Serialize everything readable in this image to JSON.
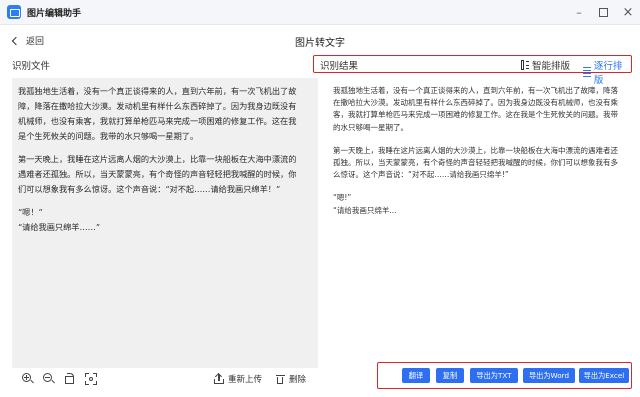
{
  "app": {
    "title": "图片编辑助手"
  },
  "nav": {
    "back_label": "返回",
    "page_title": "图片转文字"
  },
  "left": {
    "heading": "识别文件",
    "image_text": [
      "我孤独地生活着，没有一个真正谈得来的人，直到六年前，有一次飞机出了故障，降落在撒哈拉大沙漠。发动机里有样什么东西碎掉了。因为我身边既没有机械师，也没有乘客，我就打算单枪匹马来完成一项困难的修复工作。这在我是个生死攸关的问题。我带的水只够喝一星期了。",
      "第一天晚上，我睡在这片远离人烟的大沙漠上，比靠一块船板在大海中漂流的遇难者还孤独。所以，当天蒙蒙亮，有个奇怪的声音轻轻把我喊醒的时候，你们可以想象我有多么惊讶。这个声音说：“对不起……请给我画只绵羊！”",
      "“嗯！”",
      "“请给我画只绵羊……”"
    ],
    "tools": {
      "reupload_label": "重新上传",
      "delete_label": "删除"
    }
  },
  "right": {
    "heading": "识别结果",
    "mode_smart": "智能排版",
    "mode_line": "逐行排版",
    "result_text": [
      "我孤独地生活着，没有一个真正谈得来的人，直到六年前，有一次飞机出了故障，降落在撒哈拉大沙漠。发动机里有样什么东西碎掉了。因为我身边既没有机械师，也没有乘客，我就打算单枪匹马来完成一项困难的修复工作。这在我是个生死攸关的问题。我带的水只够喝一星期了。",
      "第一天晚上，我睡在这片远离人烟的大沙漠上，比靠一块船板在大海中漂流的遇难者还孤独。所以，当天蒙蒙亮，有个奇怪的声音轻轻把我喊醒的时候，你们可以想象我有多么惊讶。这个声音说：“对不起……请给我画只绵羊!”",
      "“嗯!”",
      "“请给我画只绵羊..."
    ],
    "buttons": {
      "translate": "翻译",
      "copy": "复制",
      "export_txt": "导出为TXT",
      "export_word": "导出为Word",
      "export_excel": "导出为Excel"
    }
  },
  "colors": {
    "accent": "#2d6ff0",
    "highlight_border": "#d9262c",
    "image_bg": "#f0f0f0"
  }
}
